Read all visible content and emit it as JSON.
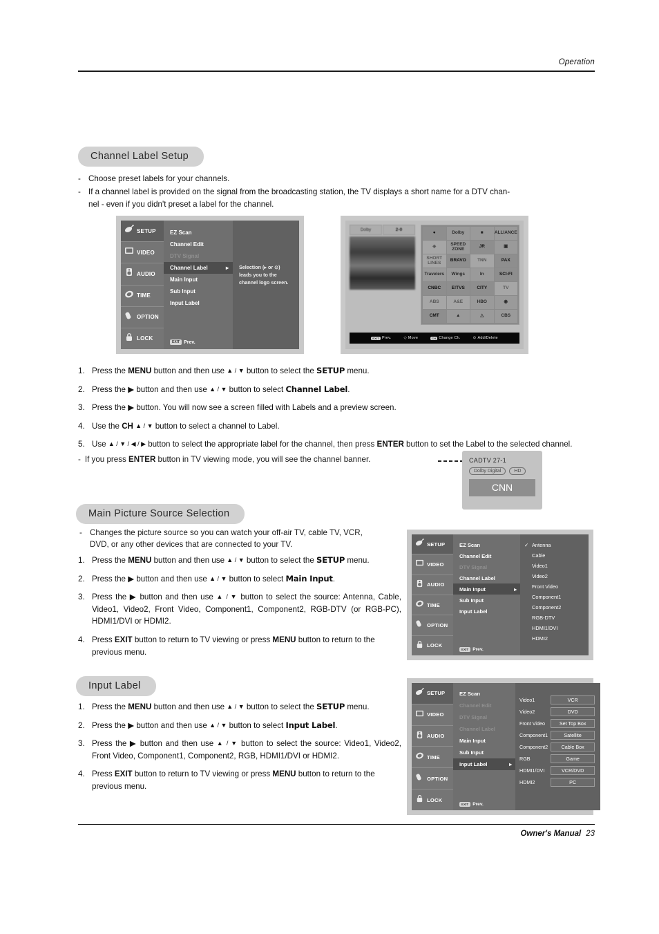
{
  "header": {
    "section_label": "Operation"
  },
  "footer": {
    "label": "Owner's Manual",
    "page_number": "23"
  },
  "section1": {
    "heading": "Channel Label Setup",
    "bullets": [
      "Choose preset labels for your channels.",
      "If a channel label is provided on the signal from the broadcasting station, the TV displays a short name for a DTV chan-nel - even if you didn't preset a label for the channel."
    ],
    "bullet1": "Choose preset labels for your channels.",
    "bullet2_line1": "If a channel label is provided on the signal from the broadcasting station, the TV displays a short name for a DTV chan-",
    "bullet2_line2": "nel - even if you didn't preset a label for the channel.",
    "steps": [
      {
        "num": "1.",
        "a": "Press the ",
        "b1": "MENU",
        "c": " button and then use ",
        "arrows": "▲ / ▼",
        "d": " button to select the ",
        "b2": "SETUP",
        "e": " menu."
      },
      {
        "num": "2.",
        "a": "Press the ▶ button and then use ",
        "arrows": "▲ / ▼",
        "d": " button to select ",
        "b2": "Channel Label",
        "e": "."
      },
      {
        "num": "3.",
        "full": "Press the ▶ button. You will now see a screen filled with Labels and a preview screen."
      },
      {
        "num": "4.",
        "a": "Use the ",
        "b1": "CH",
        "c": " ",
        "arrows": "▲ / ▼",
        "d": " button to select a channel to Label.",
        "e": ""
      },
      {
        "num": "5.",
        "a": "Use ",
        "arrows": "▲ / ▼ / ◀ / ▶",
        "d": " button to select the appropriate label for the channel, then press ",
        "b2": "ENTER",
        "e": " button to set the Label to the selected channel."
      }
    ],
    "note": {
      "a": "If you press  ",
      "b": "ENTER",
      "c": "  button in TV viewing mode, you will see the channel banner."
    }
  },
  "channel_banner": {
    "channel": "CADTV  27-1",
    "tag_audio": "Dolby Digital",
    "tag_hd": "HD",
    "name": "CNN"
  },
  "osd_menu_1": {
    "rail": [
      {
        "label": "SETUP",
        "icon": "satellite-dish-icon",
        "selected": true
      },
      {
        "label": "VIDEO",
        "icon": "monitor-icon",
        "selected": false
      },
      {
        "label": "AUDIO",
        "icon": "speaker-icon",
        "selected": false
      },
      {
        "label": "TIME",
        "icon": "clock-icon",
        "selected": false
      },
      {
        "label": "OPTION",
        "icon": "remote-icon",
        "selected": false
      },
      {
        "label": "LOCK",
        "icon": "padlock-icon",
        "selected": false
      }
    ],
    "items": [
      {
        "label": "EZ Scan",
        "state": "normal"
      },
      {
        "label": "Channel Edit",
        "state": "normal"
      },
      {
        "label": "DTV Signal",
        "state": "disabled"
      },
      {
        "label": "Channel Label",
        "state": "highlighted",
        "arrow": "▸"
      },
      {
        "label": "Main Input",
        "state": "normal"
      },
      {
        "label": "Sub Input",
        "state": "normal"
      },
      {
        "label": "Input Label",
        "state": "normal"
      }
    ],
    "prev_key": "EXIT",
    "prev_label": "Prev.",
    "help_lines": [
      "Selection (▸ or ⊙)",
      "leads you to the",
      "channel logo screen."
    ]
  },
  "osd_logo_screen": {
    "preview_channel": "Dolby",
    "preview_number": "2-0",
    "logos": [
      "●",
      "Dolby",
      "■",
      "ALLIANCE",
      "◈",
      "SPEED\nZONE",
      "JR",
      "▣",
      "SHORT\nLINES",
      "BRAVO",
      "TNN",
      "PAX",
      "Travelers",
      "Wings",
      "In",
      "SCI-FI",
      "CNBC",
      "E!TVS",
      "CITY",
      "TV",
      "ABS",
      "A&E",
      "HBO",
      "◉",
      "CMT",
      "▲",
      "△",
      "CBS"
    ],
    "footbar": [
      {
        "key": "EXIT",
        "label": "Prev."
      },
      {
        "key": "◇",
        "label": "Move"
      },
      {
        "key": "CH",
        "label": "Change Ch."
      },
      {
        "key": "⊙",
        "label": "Add/Delete"
      }
    ]
  },
  "section2": {
    "heading": "Main Picture Source Selection",
    "bullet_line1": "Changes the picture source so you can watch your off-air TV, cable TV, VCR,",
    "bullet_line2": "DVD, or any other devices that are connected to your TV.",
    "steps": [
      {
        "num": "1.",
        "a": "Press the ",
        "b1": "MENU",
        "c": " button and then use ",
        "arrows": "▲ / ▼",
        "d": " button to select the ",
        "b2": "SETUP",
        "e": " menu."
      },
      {
        "num": "2.",
        "a": "Press the ▶ button and then use ",
        "arrows": "▲ / ▼",
        "d": " button to select ",
        "b2": "Main Input",
        "e": "."
      },
      {
        "num": "3.",
        "a": "Press the ▶ button and then use ",
        "arrows": "▲ / ▼",
        "d": " button to select the source: Antenna, Cable, Video1, Video2, Front Video, Component1, Component2, RGB-DTV (or RGB-PC), HDMI1/DVI or HDMI2.",
        "e": ""
      },
      {
        "num": "4.",
        "a": "Press ",
        "b1": "EXIT",
        "c": " button to return to TV viewing or press ",
        "b2": "MENU",
        "e": " button to return to the previous menu."
      }
    ]
  },
  "osd_menu_2": {
    "rail": [
      {
        "label": "SETUP",
        "icon": "satellite-dish-icon",
        "selected": true
      },
      {
        "label": "VIDEO",
        "icon": "monitor-icon",
        "selected": false
      },
      {
        "label": "AUDIO",
        "icon": "speaker-icon",
        "selected": false
      },
      {
        "label": "TIME",
        "icon": "clock-icon",
        "selected": false
      },
      {
        "label": "OPTION",
        "icon": "remote-icon",
        "selected": false
      },
      {
        "label": "LOCK",
        "icon": "padlock-icon",
        "selected": false
      }
    ],
    "items": [
      {
        "label": "EZ Scan",
        "state": "normal"
      },
      {
        "label": "Channel Edit",
        "state": "normal"
      },
      {
        "label": "DTV Signal",
        "state": "disabled"
      },
      {
        "label": "Channel Label",
        "state": "normal"
      },
      {
        "label": "Main Input",
        "state": "highlighted",
        "arrow": "▸"
      },
      {
        "label": "Sub Input",
        "state": "normal"
      },
      {
        "label": "Input Label",
        "state": "normal"
      }
    ],
    "prev_key": "EXIT",
    "prev_label": "Prev.",
    "sources": [
      {
        "label": "Antenna",
        "checked": true
      },
      {
        "label": "Cable",
        "checked": false
      },
      {
        "label": "Video1",
        "checked": false
      },
      {
        "label": "Video2",
        "checked": false
      },
      {
        "label": "Front Video",
        "checked": false
      },
      {
        "label": "Component1",
        "checked": false
      },
      {
        "label": "Component2",
        "checked": false
      },
      {
        "label": "RGB-DTV",
        "checked": false
      },
      {
        "label": "HDMI1/DVI",
        "checked": false
      },
      {
        "label": "HDMI2",
        "checked": false
      }
    ]
  },
  "section3": {
    "heading": "Input Label",
    "steps": [
      {
        "num": "1.",
        "a": "Press the ",
        "b1": "MENU",
        "c": " button and then use ",
        "arrows": "▲ / ▼",
        "d": " button to select the ",
        "b2": "SETUP",
        "e": " menu."
      },
      {
        "num": "2.",
        "a": "Press the ▶ button and then use ",
        "arrows": "▲ / ▼",
        "d": " button to select ",
        "b2": "Input Label",
        "e": "."
      },
      {
        "num": "3.",
        "a": "Press the ▶ button and then use ",
        "arrows": "▲ / ▼",
        "d": " button to select the source: Video1, Video2, Front Video, Component1, Component2, RGB, HDMI1/DVI or HDMI2.",
        "e": ""
      },
      {
        "num": "4.",
        "a": "Press ",
        "b1": "EXIT",
        "c": " button to return to TV viewing or press ",
        "b2": "MENU",
        "e": " button to return to the previous menu."
      }
    ]
  },
  "osd_menu_3": {
    "rail": [
      {
        "label": "SETUP",
        "icon": "satellite-dish-icon",
        "selected": true
      },
      {
        "label": "VIDEO",
        "icon": "monitor-icon",
        "selected": false
      },
      {
        "label": "AUDIO",
        "icon": "speaker-icon",
        "selected": false
      },
      {
        "label": "TIME",
        "icon": "clock-icon",
        "selected": false
      },
      {
        "label": "OPTION",
        "icon": "remote-icon",
        "selected": false
      },
      {
        "label": "LOCK",
        "icon": "padlock-icon",
        "selected": false
      }
    ],
    "items": [
      {
        "label": "EZ Scan",
        "state": "normal"
      },
      {
        "label": "Channel Edit",
        "state": "disabled"
      },
      {
        "label": "DTV Signal",
        "state": "disabled"
      },
      {
        "label": "Channel Label",
        "state": "disabled"
      },
      {
        "label": "Main Input",
        "state": "normal"
      },
      {
        "label": "Sub Input",
        "state": "normal"
      },
      {
        "label": "Input Label",
        "state": "highlighted",
        "arrow": "▸"
      }
    ],
    "prev_key": "EXIT",
    "prev_label": "Prev.",
    "input_labels": [
      {
        "source": "Video1",
        "label": "VCR"
      },
      {
        "source": "Video2",
        "label": "DVD"
      },
      {
        "source": "Front Video",
        "label": "Set Top Box"
      },
      {
        "source": "Component1",
        "label": "Satellite"
      },
      {
        "source": "Component2",
        "label": "Cable Box"
      },
      {
        "source": "RGB",
        "label": "Game"
      },
      {
        "source": "HDMI1/DVI",
        "label": "VCR/DVD"
      },
      {
        "source": "HDMI2",
        "label": "PC"
      }
    ]
  }
}
